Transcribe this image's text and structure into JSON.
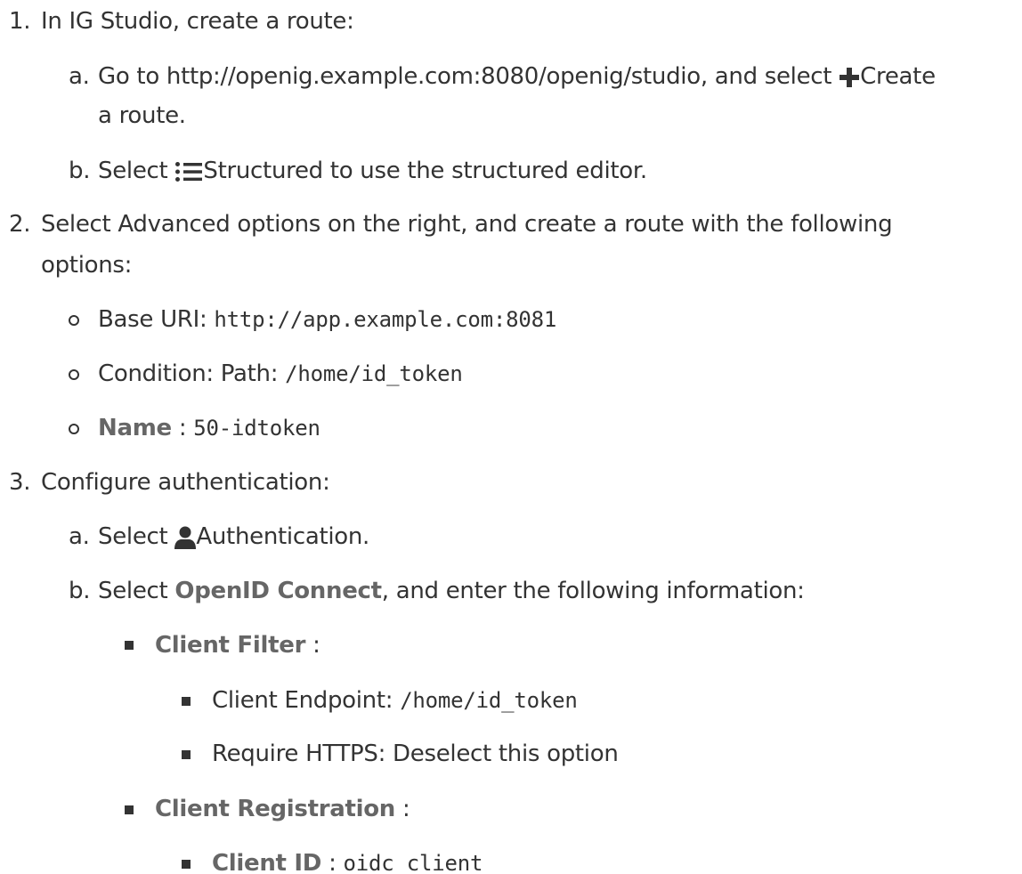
{
  "steps": [
    {
      "number": "1.",
      "text": "In IG Studio, create a route:",
      "substeps": [
        {
          "letter": "a.",
          "part1": "Go to http://openig.example.com:8080/openig/studio, and select",
          "icon": "plus-icon",
          "part2": "Create",
          "part3": "a route."
        },
        {
          "letter": "b.",
          "part1": "Select",
          "icon": "list-icon",
          "part2": "Structured to use the structured editor."
        }
      ]
    },
    {
      "number": "2.",
      "text": "Select Advanced options on the right, and create a route with the following",
      "text_cont": "options:",
      "options": [
        {
          "label": "Base URI:",
          "code": "http://app.example.com:8081"
        },
        {
          "label": "Condition: Path:",
          "code": "/home/id_token"
        },
        {
          "label": "Name",
          "sep": ":",
          "code": "50-idtoken"
        }
      ]
    },
    {
      "number": "3.",
      "text": "Configure authentication:",
      "substeps": [
        {
          "letter": "a.",
          "part1": "Select",
          "icon": "user-icon",
          "part2": "Authentication."
        },
        {
          "letter": "b.",
          "part1": "Select",
          "bold": "OpenID Connect",
          "part2": ", and enter the following information:",
          "items": [
            {
              "label": "Client Filter",
              "sep": ":",
              "subitems": [
                {
                  "label": "Client Endpoint:",
                  "code": "/home/id_token"
                },
                {
                  "label": "Require HTTPS: Deselect this option"
                }
              ]
            },
            {
              "label": "Client Registration",
              "sep": ":",
              "subitems": [
                {
                  "label": "Client ID",
                  "sep": ":",
                  "code": "oidc_client"
                }
              ]
            }
          ]
        }
      ]
    }
  ]
}
